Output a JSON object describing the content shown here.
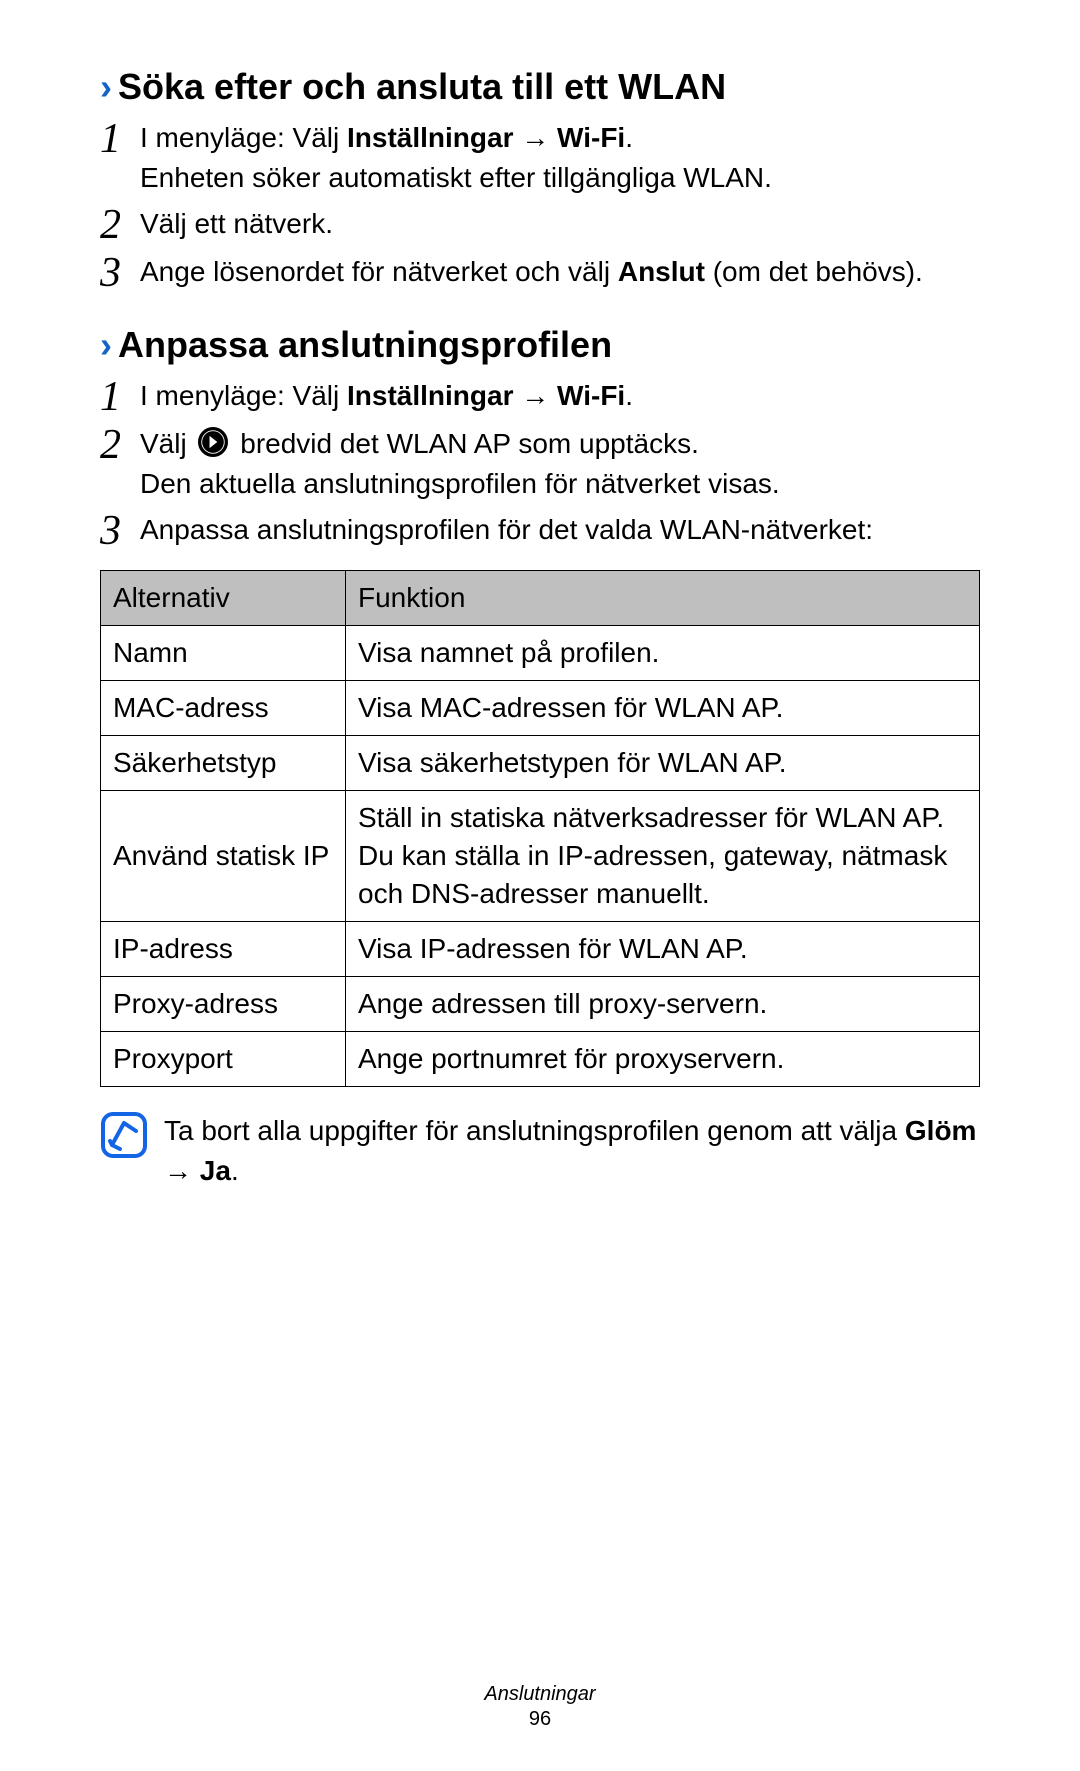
{
  "section1": {
    "heading": "Söka efter och ansluta till ett WLAN",
    "steps": [
      {
        "num": "1",
        "pre": "I menyläge: Välj ",
        "bold1": "Inställningar",
        "arrow": " → ",
        "bold2": "Wi-Fi",
        "post": ".",
        "line2": "Enheten söker automatiskt efter tillgängliga WLAN."
      },
      {
        "num": "2",
        "text": "Välj ett nätverk."
      },
      {
        "num": "3",
        "pre": "Ange lösenordet för nätverket och välj ",
        "bold1": "Anslut",
        "post": " (om det behövs)."
      }
    ]
  },
  "section2": {
    "heading": "Anpassa anslutningsprofilen",
    "steps": [
      {
        "num": "1",
        "pre": "I menyläge: Välj ",
        "bold1": "Inställningar",
        "arrow": " → ",
        "bold2": "Wi-Fi",
        "post": "."
      },
      {
        "num": "2",
        "pre": "Välj ",
        "iconname": "arrow-circle-icon",
        "post1": " bredvid det WLAN AP som upptäcks.",
        "line2": "Den aktuella anslutningsprofilen för nätverket visas."
      },
      {
        "num": "3",
        "text": "Anpassa anslutningsprofilen för det valda WLAN-nätverket:"
      }
    ]
  },
  "table": {
    "header": {
      "col1": "Alternativ",
      "col2": "Funktion"
    },
    "rows": [
      {
        "opt": "Namn",
        "func": "Visa namnet på profilen."
      },
      {
        "opt": "MAC-adress",
        "func": "Visa MAC-adressen för WLAN AP."
      },
      {
        "opt": "Säkerhetstyp",
        "func": "Visa säkerhetstypen för WLAN AP."
      },
      {
        "opt": "Använd statisk IP",
        "func": "Ställ in statiska nätverksadresser för WLAN AP. Du kan ställa in IP-adressen, gateway, nätmask och DNS-adresser manuellt."
      },
      {
        "opt": "IP-adress",
        "func": "Visa IP-adressen för WLAN AP."
      },
      {
        "opt": "Proxy-adress",
        "func": "Ange adressen till proxy-servern."
      },
      {
        "opt": "Proxyport",
        "func": "Ange portnumret för proxyservern."
      }
    ]
  },
  "note": {
    "pre": "Ta bort alla uppgifter för anslutningsprofilen genom att välja ",
    "bold1": "Glöm",
    "arrow": " → ",
    "bold2": "Ja",
    "post": "."
  },
  "footer": {
    "category": "Anslutningar",
    "page": "96"
  }
}
